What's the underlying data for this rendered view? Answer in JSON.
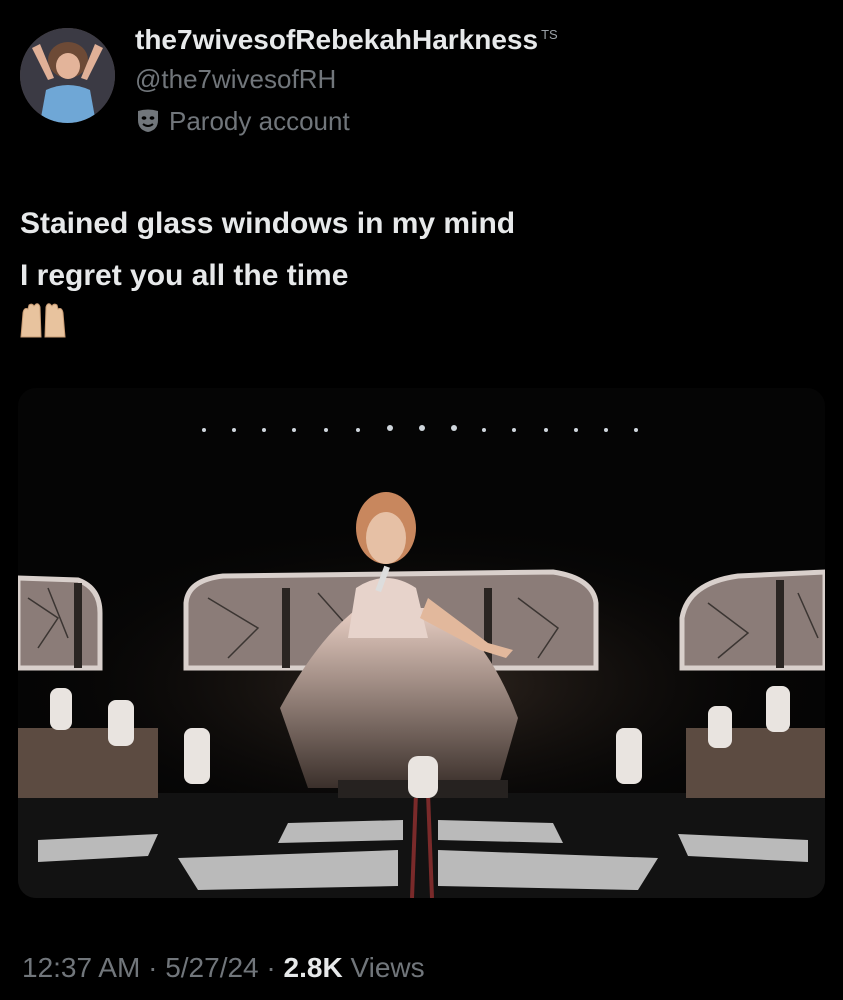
{
  "profile": {
    "display_name": "the7wivesofRebekahHarkness",
    "name_badge": "TS",
    "handle": "@the7wivesofRH",
    "label": "Parody account",
    "avatar_icon": "profile-photo"
  },
  "tweet": {
    "lines": [
      "Stained glass windows in my mind",
      "I regret you all the time"
    ],
    "emoji_icon": "raised-hands-emoji",
    "media_icon": "concert-stage-photo"
  },
  "meta": {
    "time": "12:37 AM",
    "separator": "·",
    "date": "5/27/24",
    "views_count": "2.8K",
    "views_label": "Views"
  },
  "colors": {
    "background": "#000000",
    "primary_text": "#e7e9ea",
    "secondary_text": "#71767b"
  }
}
